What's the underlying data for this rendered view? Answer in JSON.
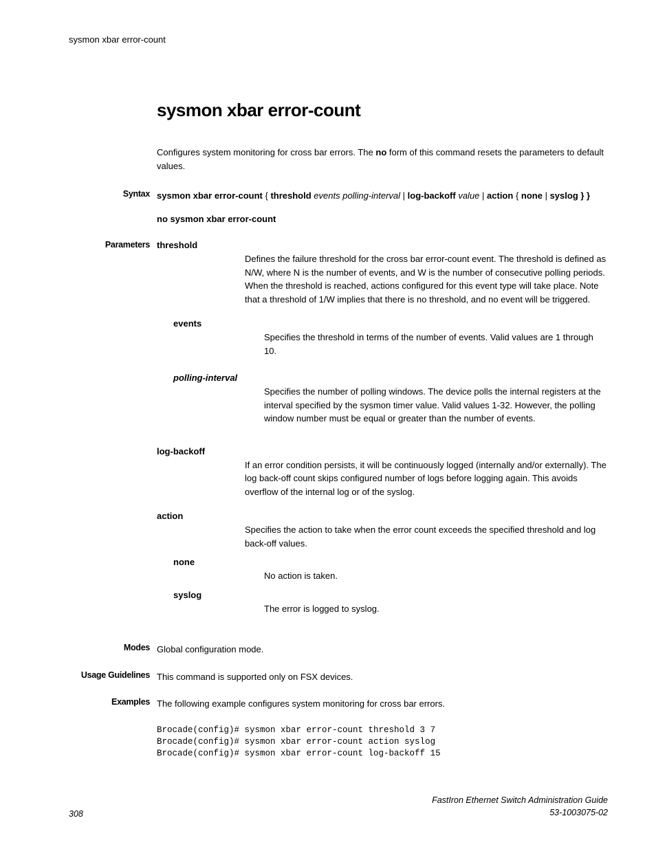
{
  "running_header": "sysmon xbar error-count",
  "title": "sysmon xbar error-count",
  "description_pre": "Configures system monitoring for cross bar errors. The ",
  "description_bold": "no",
  "description_post": " form of this command resets the parameters to default values.",
  "labels": {
    "syntax": "Syntax",
    "parameters": "Parameters",
    "modes": "Modes",
    "usage": "Usage Guidelines",
    "examples": "Examples"
  },
  "syntax": {
    "cmd": "sysmon xbar error-count",
    "brace_open": " { ",
    "threshold": "threshold",
    "events": " events polling-interval",
    "pipe1": " | ",
    "logbackoff": "log-backoff",
    "value": " value",
    "pipe2": " | ",
    "action": "action",
    "brace_open2": " { ",
    "none": "none",
    "pipe3": " | ",
    "syslog": "syslog",
    "close": " } }",
    "no_form": "no sysmon xbar error-count"
  },
  "params": {
    "threshold": {
      "name": "threshold",
      "desc": "Defines the failure threshold for the cross bar error-count event. The threshold is defined as N/W, where N is the number of events, and W is the number of consecutive polling periods. When the threshold is reached, actions configured for this event type will take place. Note that a threshold of 1/W implies that there is no threshold, and no event will be triggered."
    },
    "events": {
      "name": "events",
      "desc": "Specifies the threshold in terms of the number of events. Valid values are 1 through 10."
    },
    "polling": {
      "name": "polling-interval",
      "desc": "Specifies the number of polling windows. The device polls the internal registers at the interval specified by the sysmon timer value. Valid values 1-32. However, the polling window number must be equal or greater than the number of events."
    },
    "logbackoff": {
      "name": "log-backoff",
      "desc": "If an error condition persists, it will be continuously logged (internally and/or externally). The log back-off count skips configured number of logs before logging again. This avoids overflow of the internal log or of the syslog."
    },
    "action": {
      "name": "action",
      "desc": "Specifies the action to take when the error count exceeds the specified threshold and log back-off values."
    },
    "none": {
      "name": "none",
      "desc": "No action is taken."
    },
    "syslog": {
      "name": "syslog",
      "desc": "The error is logged to syslog."
    }
  },
  "modes": "Global configuration mode.",
  "usage": "This command is supported only on FSX devices.",
  "examples_intro": "The following example configures system monitoring for cross bar errors.",
  "code": "Brocade(config)# sysmon xbar error-count threshold 3 7\nBrocade(config)# sysmon xbar error-count action syslog\nBrocade(config)# sysmon xbar error-count log-backoff 15",
  "footer": {
    "page": "308",
    "guide": "FastIron Ethernet Switch Administration Guide",
    "docnum": "53-1003075-02"
  }
}
